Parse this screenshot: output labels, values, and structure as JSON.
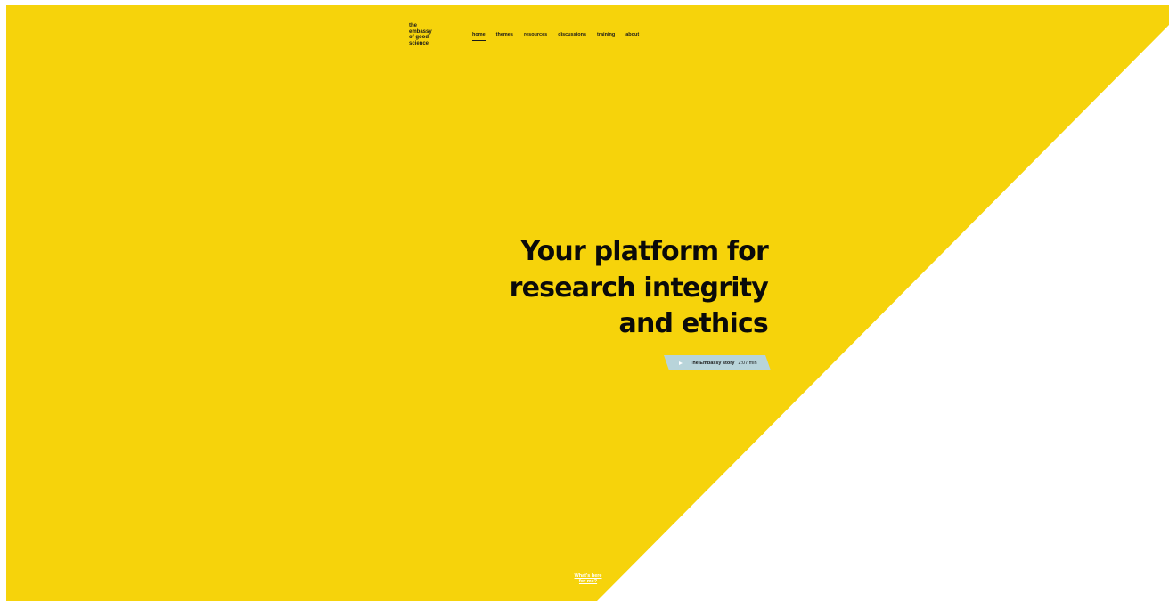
{
  "brand": {
    "logo_lines": [
      "the",
      "embassy",
      "of good",
      "science"
    ],
    "colors": {
      "accent": "#F6D30B",
      "background": "#FFFFFF",
      "text": "#0A0A0A",
      "story_button": "#B8D4DA"
    }
  },
  "nav": {
    "items": [
      {
        "label": "home",
        "active": true
      },
      {
        "label": "themes",
        "active": false
      },
      {
        "label": "resources",
        "active": false
      },
      {
        "label": "discussions",
        "active": false
      },
      {
        "label": "training",
        "active": false
      },
      {
        "label": "about",
        "active": false
      }
    ]
  },
  "hero": {
    "title_lines": [
      "Your platform for",
      "research integrity",
      "and ethics"
    ],
    "story_button": {
      "icon": "play-icon",
      "label": "The Embassy story",
      "duration": "2:07 min"
    }
  },
  "footer": {
    "whats_here_lines": [
      "What's here",
      "for me?"
    ]
  }
}
